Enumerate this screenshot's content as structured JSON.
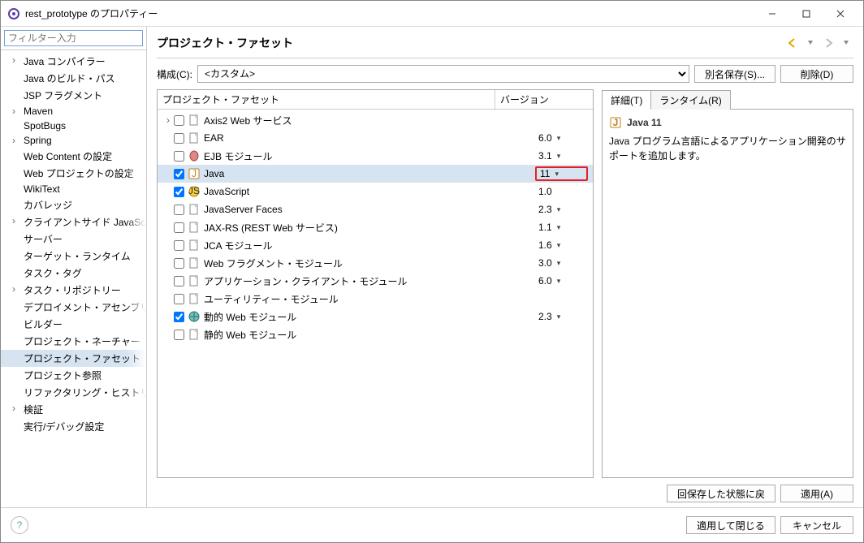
{
  "window": {
    "title": "rest_prototype のプロパティー"
  },
  "filter": {
    "placeholder": "フィルター入力"
  },
  "sidebar": {
    "items": [
      {
        "label": "Java コンパイラー",
        "arrow": true
      },
      {
        "label": "Java のビルド・パス",
        "arrow": false
      },
      {
        "label": "JSP フラグメント",
        "arrow": false
      },
      {
        "label": "Maven",
        "arrow": true
      },
      {
        "label": "SpotBugs",
        "arrow": false
      },
      {
        "label": "Spring",
        "arrow": true
      },
      {
        "label": "Web Content の設定",
        "arrow": false
      },
      {
        "label": "Web プロジェクトの設定",
        "arrow": false
      },
      {
        "label": "WikiText",
        "arrow": false
      },
      {
        "label": "カバレッジ",
        "arrow": false
      },
      {
        "label": "クライアントサイド JavaScript",
        "arrow": true
      },
      {
        "label": "サーバー",
        "arrow": false
      },
      {
        "label": "ターゲット・ランタイム",
        "arrow": false
      },
      {
        "label": "タスク・タグ",
        "arrow": false
      },
      {
        "label": "タスク・リポジトリー",
        "arrow": true
      },
      {
        "label": "デプロイメント・アセンブリー",
        "arrow": false
      },
      {
        "label": "ビルダー",
        "arrow": false
      },
      {
        "label": "プロジェクト・ネーチャー",
        "arrow": false
      },
      {
        "label": "プロジェクト・ファセット",
        "arrow": false,
        "selected": true
      },
      {
        "label": "プロジェクト参照",
        "arrow": false
      },
      {
        "label": "リファクタリング・ヒストリー",
        "arrow": false
      },
      {
        "label": "検証",
        "arrow": true
      },
      {
        "label": "実行/デバッグ設定",
        "arrow": false
      }
    ]
  },
  "page": {
    "title": "プロジェクト・ファセット"
  },
  "config": {
    "label": "構成(C):",
    "value": "<カスタム>",
    "save_as": "別名保存(S)...",
    "delete": "削除(D)"
  },
  "facet_header": {
    "name": "プロジェクト・ファセット",
    "version": "バージョン"
  },
  "facets": [
    {
      "name": "Axis2 Web サービス",
      "version": "",
      "checked": false,
      "expandable": true,
      "icon": "doc",
      "dropdown": false
    },
    {
      "name": "EAR",
      "version": "6.0",
      "checked": false,
      "icon": "doc",
      "dropdown": true
    },
    {
      "name": "EJB モジュール",
      "version": "3.1",
      "checked": false,
      "icon": "bean",
      "dropdown": true
    },
    {
      "name": "Java",
      "version": "11",
      "checked": true,
      "icon": "java",
      "dropdown": true,
      "highlight": true,
      "selected": true
    },
    {
      "name": "JavaScript",
      "version": "1.0",
      "checked": true,
      "icon": "js",
      "dropdown": false
    },
    {
      "name": "JavaServer Faces",
      "version": "2.3",
      "checked": false,
      "icon": "doc",
      "dropdown": true
    },
    {
      "name": "JAX-RS (REST Web サービス)",
      "version": "1.1",
      "checked": false,
      "icon": "doc",
      "dropdown": true
    },
    {
      "name": "JCA モジュール",
      "version": "1.6",
      "checked": false,
      "icon": "doc",
      "dropdown": true
    },
    {
      "name": "Web フラグメント・モジュール",
      "version": "3.0",
      "checked": false,
      "icon": "doc",
      "dropdown": true
    },
    {
      "name": "アプリケーション・クライアント・モジュール",
      "version": "6.0",
      "checked": false,
      "icon": "doc",
      "dropdown": true
    },
    {
      "name": "ユーティリティー・モジュール",
      "version": "",
      "checked": false,
      "icon": "doc",
      "dropdown": false
    },
    {
      "name": "動的 Web モジュール",
      "version": "2.3",
      "checked": true,
      "icon": "globe",
      "dropdown": true
    },
    {
      "name": "静的 Web モジュール",
      "version": "",
      "checked": false,
      "icon": "doc",
      "dropdown": false
    }
  ],
  "tabs": {
    "details": "詳細(T)",
    "runtime": "ランタイム(R)"
  },
  "details": {
    "title": "Java 11",
    "desc": "Java プログラム言語によるアプリケーション開発のサポートを追加します。"
  },
  "buttons": {
    "restore": "回保存した状態に戻",
    "apply": "適用(A)",
    "apply_close": "適用して閉じる",
    "cancel": "キャンセル"
  }
}
